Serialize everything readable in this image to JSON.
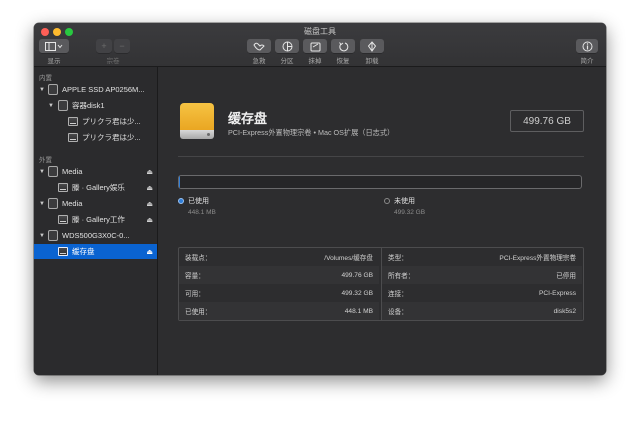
{
  "window": {
    "title": "磁盘工具"
  },
  "toolbar": {
    "view_label": "显示",
    "volume_label": "宗卷",
    "add_symbol": "+",
    "remove_symbol": "−",
    "buttons": [
      {
        "label": "急救",
        "icon": "first-aid-icon"
      },
      {
        "label": "分区",
        "icon": "partition-icon"
      },
      {
        "label": "抹掉",
        "icon": "erase-icon"
      },
      {
        "label": "恢复",
        "icon": "restore-icon"
      },
      {
        "label": "卸载",
        "icon": "unmount-icon"
      }
    ],
    "info_label": "简介",
    "info_symbol": "i"
  },
  "sidebar": {
    "internal_header": "内置",
    "external_header": "外置",
    "items": [
      {
        "label": "APPLE SSD AP0256M..."
      },
      {
        "label": "容器disk1"
      },
      {
        "label": "プリクラ君は少..."
      },
      {
        "label": "プリクラ君は少..."
      },
      {
        "label": "Media"
      },
      {
        "label": "滕 · Gallery娱乐"
      },
      {
        "label": "Media"
      },
      {
        "label": "滕 · Gallery工作"
      },
      {
        "label": "WDS500G3X0C-0..."
      },
      {
        "label": "缓存盘"
      }
    ]
  },
  "volume": {
    "name": "缓存盘",
    "description": "PCI-Express外置物理宗卷 • Mac OS扩展（日志式）",
    "capacity": "499.76 GB"
  },
  "usage": {
    "used_label": "已使用",
    "used_value": "448.1 MB",
    "free_label": "未使用",
    "free_value": "499.32 GB",
    "used_fraction": 0.0009,
    "used_color": "#2f7ed8"
  },
  "info_table": {
    "left": [
      {
        "key": "装载点：",
        "value": "/Volumes/缓存盘"
      },
      {
        "key": "容量：",
        "value": "499.76 GB"
      },
      {
        "key": "可用：",
        "value": "499.32 GB"
      },
      {
        "key": "已使用：",
        "value": "448.1 MB"
      }
    ],
    "right": [
      {
        "key": "类型：",
        "value": "PCI-Express外置物理宗卷"
      },
      {
        "key": "所有者：",
        "value": "已停用"
      },
      {
        "key": "连接：",
        "value": "PCI-Express"
      },
      {
        "key": "设备：",
        "value": "disk5s2"
      }
    ]
  }
}
